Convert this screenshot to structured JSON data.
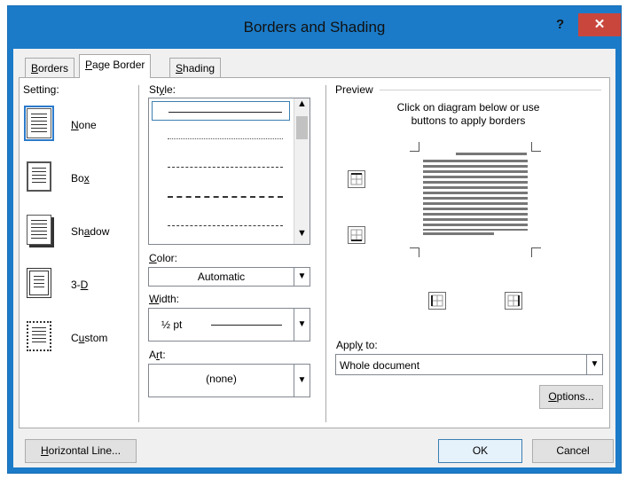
{
  "dialog": {
    "title": "Borders and Shading",
    "help": "?",
    "close": "✕"
  },
  "tabs": [
    {
      "label": "Borders",
      "accel": "B",
      "rest": "orders",
      "active": false
    },
    {
      "label": "Page Border",
      "accel": "P",
      "rest": "age Border",
      "active": true
    },
    {
      "label": "Shading",
      "accel": "S",
      "rest": "hading",
      "active": false
    }
  ],
  "setting": {
    "label": "Setting:",
    "options": [
      {
        "label": "None",
        "pre": "",
        "accel": "N",
        "post": "one",
        "selected": true
      },
      {
        "label": "Box",
        "pre": "Bo",
        "accel": "x",
        "post": "",
        "selected": false
      },
      {
        "label": "Shadow",
        "pre": "Sh",
        "accel": "a",
        "post": "dow",
        "selected": false
      },
      {
        "label": "3-D",
        "pre": "3-",
        "accel": "D",
        "post": "",
        "selected": false
      },
      {
        "label": "Custom",
        "pre": "C",
        "accel": "u",
        "post": "stom",
        "selected": false
      }
    ]
  },
  "style": {
    "label_pre": "St",
    "label_accel": "y",
    "label_post": "le:",
    "items": [
      "solid",
      "dotted",
      "dashed-small",
      "dashed",
      "dash-dot"
    ],
    "selected_index": 0
  },
  "color": {
    "label_accel": "C",
    "label_post": "olor:",
    "value": "Automatic"
  },
  "width": {
    "label_accel": "W",
    "label_post": "idth:",
    "value": "½ pt"
  },
  "art": {
    "label_pre": "A",
    "label_accel": "r",
    "label_post": "t:",
    "value": "(none)"
  },
  "preview": {
    "label": "Preview",
    "instruction_line1": "Click on diagram below or use",
    "instruction_line2": "buttons to apply borders"
  },
  "apply_to": {
    "label_pre": "Appl",
    "label_accel": "y",
    "label_post": " to:",
    "value": "Whole document"
  },
  "buttons": {
    "options": {
      "accel": "O",
      "rest": "ptions..."
    },
    "horizontal_line": {
      "accel": "H",
      "rest": "orizontal Line..."
    },
    "ok": "OK",
    "cancel": "Cancel"
  },
  "colors": {
    "titlebar": "#1b7bc8",
    "close": "#c9463d",
    "selection": "#2a7acb"
  }
}
